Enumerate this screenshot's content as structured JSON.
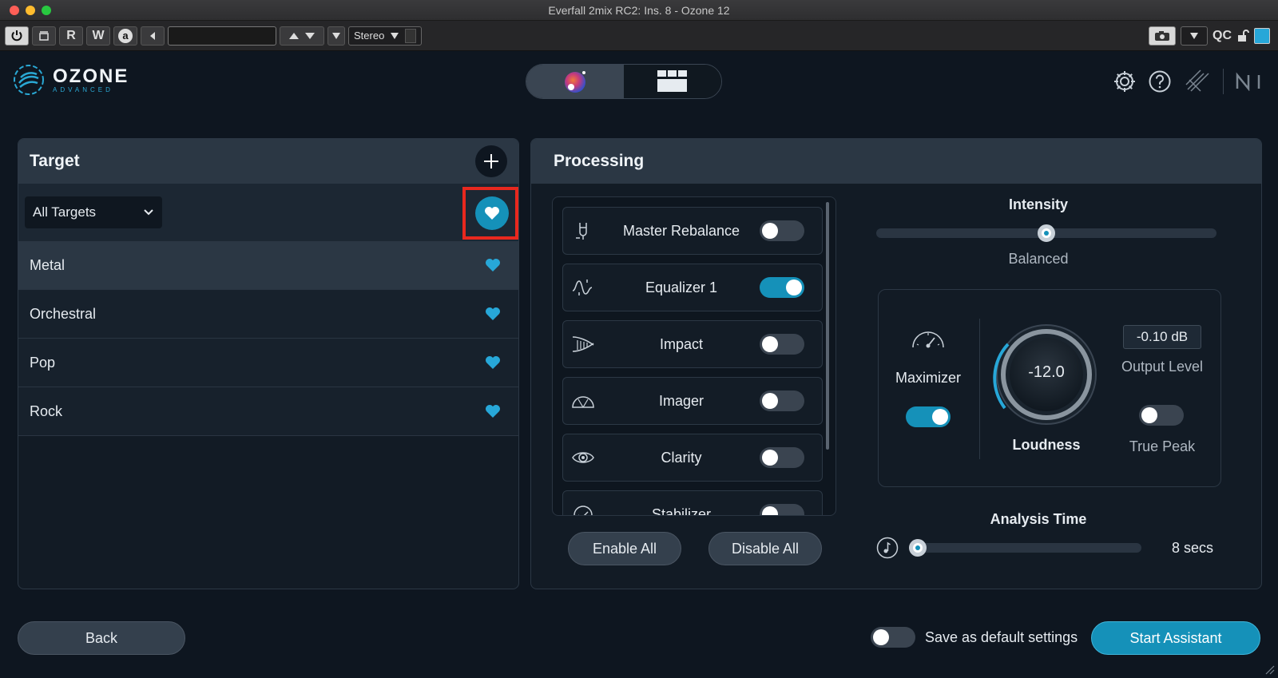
{
  "window": {
    "title": "Everfall 2mix RC2: Ins. 8 - Ozone 12"
  },
  "host_toolbar": {
    "read_label": "R",
    "write_label": "W",
    "auto_label": "a",
    "channel_mode": "Stereo",
    "qc_label": "QC"
  },
  "app": {
    "logo_name": "OZONE",
    "logo_sub": "ADVANCED"
  },
  "target": {
    "title": "Target",
    "filter_value": "All Targets",
    "items": [
      {
        "label": "Metal",
        "selected": true
      },
      {
        "label": "Orchestral",
        "selected": false
      },
      {
        "label": "Pop",
        "selected": false
      },
      {
        "label": "Rock",
        "selected": false
      }
    ]
  },
  "processing": {
    "title": "Processing",
    "modules": [
      {
        "label": "Master Rebalance",
        "icon": "tuning-fork-icon",
        "enabled": false
      },
      {
        "label": "Equalizer 1",
        "icon": "eq-curve-icon",
        "enabled": true
      },
      {
        "label": "Impact",
        "icon": "impact-icon",
        "enabled": false
      },
      {
        "label": "Imager",
        "icon": "imager-icon",
        "enabled": false
      },
      {
        "label": "Clarity",
        "icon": "eye-icon",
        "enabled": false
      },
      {
        "label": "Stabilizer",
        "icon": "stabilizer-icon",
        "enabled": false
      }
    ],
    "enable_all_label": "Enable All",
    "disable_all_label": "Disable All",
    "intensity": {
      "title": "Intensity",
      "value_label": "Balanced",
      "value": 0.5
    },
    "maximizer": {
      "label": "Maximizer",
      "enabled": true
    },
    "loudness": {
      "label": "Loudness",
      "value": "-12.0"
    },
    "output_level": {
      "label": "Output Level",
      "value": "-0.10 dB"
    },
    "true_peak": {
      "label": "True Peak",
      "enabled": false
    },
    "analysis_time": {
      "title": "Analysis Time",
      "value_label": "8 secs",
      "value": 0.0
    }
  },
  "footer": {
    "back_label": "Back",
    "save_default_label": "Save as default settings",
    "save_default_enabled": false,
    "start_label": "Start Assistant"
  },
  "colors": {
    "accent": "#1591b9",
    "highlight": "#e8281e",
    "background": "#0e1620"
  }
}
